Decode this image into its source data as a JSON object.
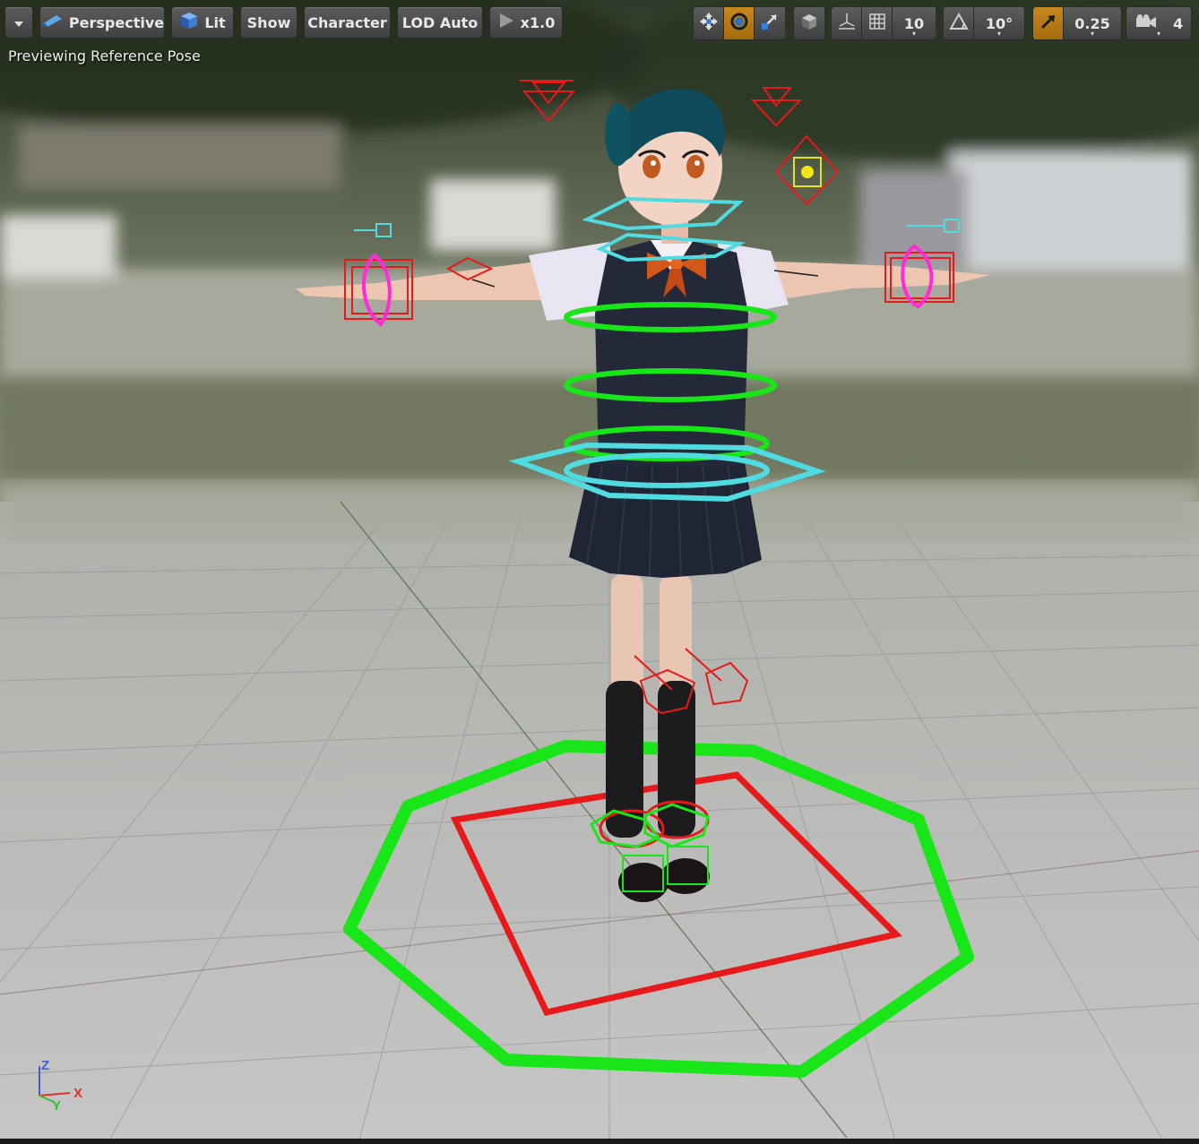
{
  "toolbar": {
    "menu_icon": "chevron-down-icon",
    "perspective_label": "Perspective",
    "lit_label": "Lit",
    "show_label": "Show",
    "character_label": "Character",
    "lod_label": "LOD Auto",
    "speed_label": "x1.0",
    "grid_snap_value": "10",
    "rotation_snap_value": "10°",
    "scale_snap_value": "0.25",
    "camera_speed_value": "4"
  },
  "status_text": "Previewing Reference Pose",
  "axis": {
    "x": "X",
    "y": "Y",
    "z": "Z"
  },
  "colors": {
    "accent": "#c7871d",
    "control_green": "#19e619",
    "control_red": "#e61a1a",
    "control_cyan": "#4fdbe0",
    "control_magenta": "#ff2bd6"
  }
}
